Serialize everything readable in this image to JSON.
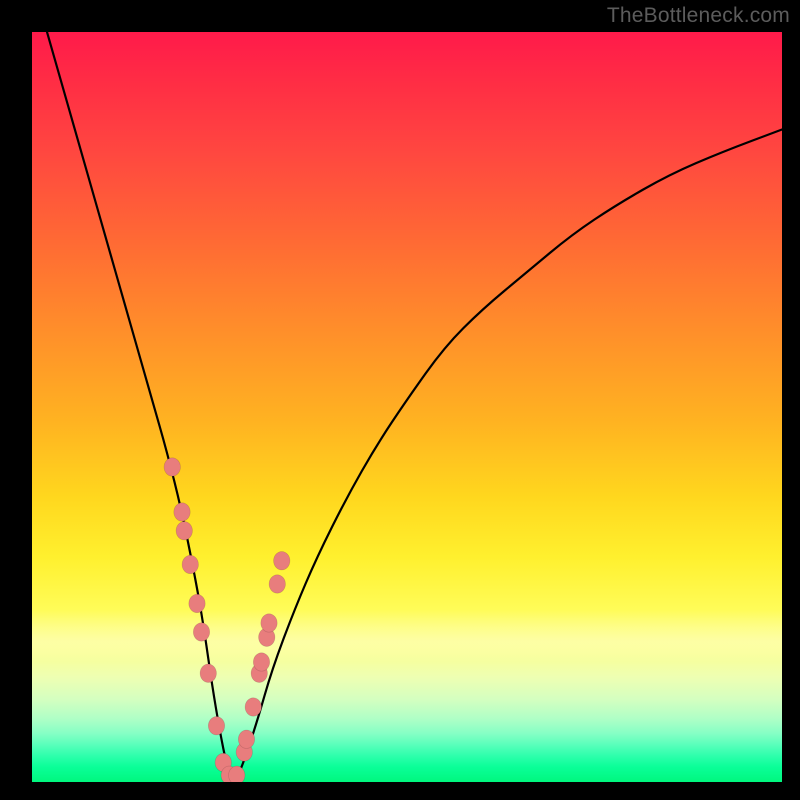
{
  "watermark": "TheBottleneck.com",
  "colors": {
    "curve_stroke": "#000000",
    "dot_fill": "#e87d7d",
    "dot_stroke": "rgba(0,0,0,0.15)",
    "frame": "#000000"
  },
  "chart_data": {
    "type": "line",
    "title": "",
    "xlabel": "",
    "ylabel": "",
    "xlim": [
      0,
      100
    ],
    "ylim": [
      0,
      100
    ],
    "grid": false,
    "legend": false,
    "series": [
      {
        "name": "bottleneck-curve",
        "x": [
          2,
          4,
          6,
          8,
          10,
          12,
          14,
          16,
          18,
          20,
          22,
          23,
          24,
          25,
          26,
          27,
          28,
          30,
          32,
          35,
          38,
          42,
          46,
          50,
          55,
          60,
          66,
          72,
          78,
          85,
          92,
          100
        ],
        "y": [
          100,
          93,
          86,
          79,
          72,
          65,
          58,
          51,
          44,
          36,
          26,
          20,
          13,
          7,
          2,
          0,
          2,
          8,
          15,
          23,
          30,
          38,
          45,
          51,
          58,
          63,
          68,
          73,
          77,
          81,
          84,
          87
        ]
      }
    ],
    "data_points": {
      "name": "highlighted-components",
      "x": [
        18.7,
        20.0,
        20.3,
        21.1,
        22.0,
        22.6,
        23.5,
        24.6,
        25.5,
        26.3,
        27.3,
        28.3,
        28.6,
        29.5,
        30.3,
        30.6,
        31.3,
        31.6,
        32.7,
        33.3
      ],
      "y": [
        42.0,
        36.0,
        33.5,
        29.0,
        23.8,
        20.0,
        14.5,
        7.5,
        2.6,
        0.9,
        0.9,
        4.0,
        5.7,
        10.0,
        14.5,
        16.0,
        19.3,
        21.2,
        26.4,
        29.5
      ]
    }
  }
}
